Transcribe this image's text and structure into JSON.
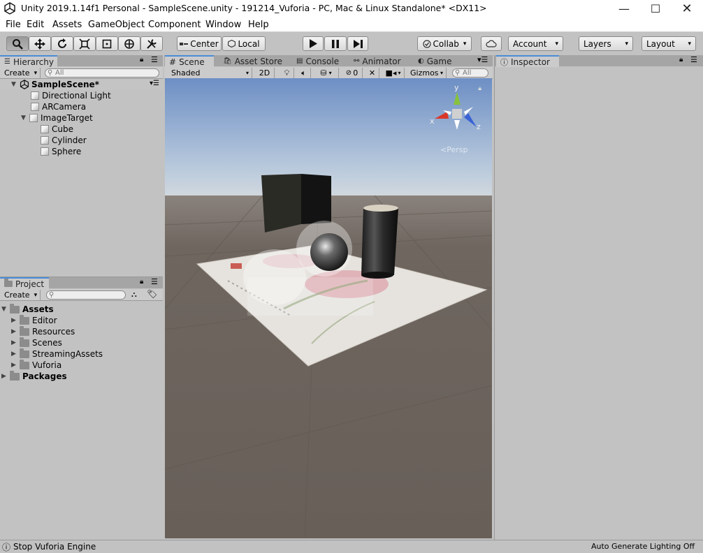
{
  "window": {
    "title": "Unity 2019.1.14f1 Personal - SampleScene.unity - 191214_Vuforia - PC, Mac & Linux Standalone* <DX11>"
  },
  "menu": [
    "File",
    "Edit",
    "Assets",
    "GameObject",
    "Component",
    "Window",
    "Help"
  ],
  "toolbar": {
    "center_label": "Center",
    "local_label": "Local",
    "collab_label": "Collab",
    "account_label": "Account",
    "layers_label": "Layers",
    "layout_label": "Layout"
  },
  "hierarchy": {
    "tab": "Hierarchy",
    "create": "Create",
    "search_placeholder": "All",
    "scene": "SampleScene*",
    "items": [
      "Directional Light",
      "ARCamera",
      "ImageTarget",
      "Cube",
      "Cylinder",
      "Sphere"
    ]
  },
  "project": {
    "tab": "Project",
    "create": "Create",
    "root": "Assets",
    "folders": [
      "Editor",
      "Resources",
      "Scenes",
      "StreamingAssets",
      "Vuforia"
    ],
    "packages": "Packages"
  },
  "scene_view": {
    "tabs": [
      "Scene",
      "Asset Store",
      "Console",
      "Animator",
      "Game"
    ],
    "shading": "Shaded",
    "mode_2d": "2D",
    "hidden_count": "0",
    "gizmos": "Gizmos",
    "search_placeholder": "All",
    "persp": "Persp",
    "axis_y": "y",
    "axis_x": "x",
    "axis_z": "z"
  },
  "inspector": {
    "tab": "Inspector"
  },
  "status": {
    "left": "Stop Vuforia Engine",
    "right": "Auto Generate Lighting Off"
  },
  "colors": {
    "accent": "#4a8dd9",
    "panel": "#c2c2c2",
    "tabbar": "#a5a5a5",
    "scene_ground": "#675f58",
    "sky": "#8aa8cf"
  }
}
